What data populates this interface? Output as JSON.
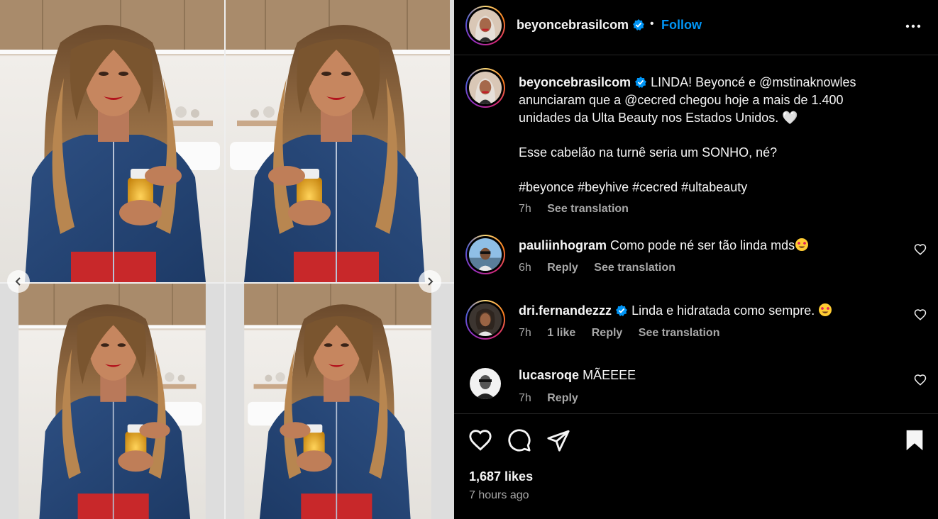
{
  "post": {
    "username": "beyoncebrasilcom",
    "follow_label": "Follow",
    "dot": "•",
    "more_icon": "more-horizontal-icon"
  },
  "caption": {
    "username": "beyoncebrasilcom",
    "line1": "LINDA! Beyoncé e @mstinaknowles",
    "line2": "anunciaram que a @cecred chegou hoje a mais de 1.400",
    "line3": "unidades da Ulta Beauty nos Estados Unidos. 🤍",
    "line4": "Esse cabelão na turnê seria um SONHO, né?",
    "line5": "#beyonce #beyhive #cecred #ultabeauty",
    "time": "7h",
    "see_translation": "See translation"
  },
  "comments": [
    {
      "username": "pauliinhogram",
      "text": "Como pode né ser tão linda mds",
      "time": "6h",
      "reply": "Reply",
      "see_translation": "See translation"
    },
    {
      "username": "dri.fernandezzz",
      "text": "Linda e hidratada como sempre. ",
      "time": "7h",
      "likes": "1 like",
      "reply": "Reply",
      "see_translation": "See translation"
    },
    {
      "username": "lucasroqe",
      "text": "MÃEEEE",
      "time": "7h",
      "reply": "Reply"
    }
  ],
  "actions": {
    "likes": "1,687 likes",
    "posted": "7 hours ago"
  },
  "colors": {
    "accent": "#0095f6",
    "background": "#000000",
    "muted": "#a8a8a8"
  }
}
